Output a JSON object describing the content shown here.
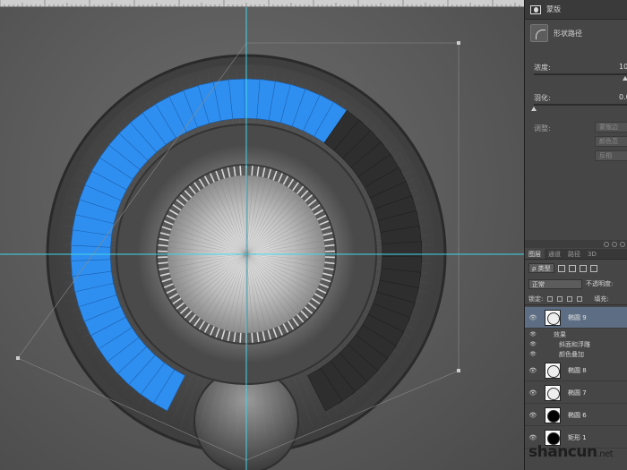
{
  "panel": {
    "title": "蒙版",
    "path_label": "形状路径",
    "density": {
      "label": "浓度:",
      "value": "10",
      "fraction": 1.0
    },
    "feather": {
      "label": "羽化:",
      "value": "0.0",
      "fraction": 0.0
    },
    "adjust_label": "调整:",
    "adjust_buttons": [
      "蒙版边",
      "颜色范",
      "反相"
    ]
  },
  "layers_panel": {
    "tabs": [
      "图层",
      "通道",
      "路径",
      "3D"
    ],
    "active_tab": 0,
    "filter_select": "ρ 类型",
    "blend_mode": "正常",
    "opacity_label": "不透明度:",
    "lock_label": "锁定:",
    "fill_label": "填充:",
    "layers": [
      {
        "name": "椭圆 9",
        "selected": true,
        "thumb": "white"
      },
      {
        "name": "椭圆 8",
        "selected": false,
        "thumb": "white"
      },
      {
        "name": "椭圆 7",
        "selected": false,
        "thumb": "white"
      },
      {
        "name": "椭圆 6",
        "selected": false,
        "thumb": "dark"
      },
      {
        "name": "矩形 1",
        "selected": false,
        "thumb": "dark"
      }
    ],
    "effects": {
      "title": "效果",
      "items": [
        "斜面和浮雕",
        "颜色叠加"
      ]
    }
  },
  "watermark": {
    "main": "shancun",
    "suffix": ".net"
  },
  "colors": {
    "accent_blue": "#2f8ff0",
    "guide": "#3fd4e6",
    "selected_layer": "#5d6e84"
  },
  "icons": [
    "mask-icon",
    "shape-path-icon",
    "eye-icon",
    "lock-icon",
    "fx-icon"
  ],
  "art": {
    "blue_arc_fraction": 0.4
  }
}
